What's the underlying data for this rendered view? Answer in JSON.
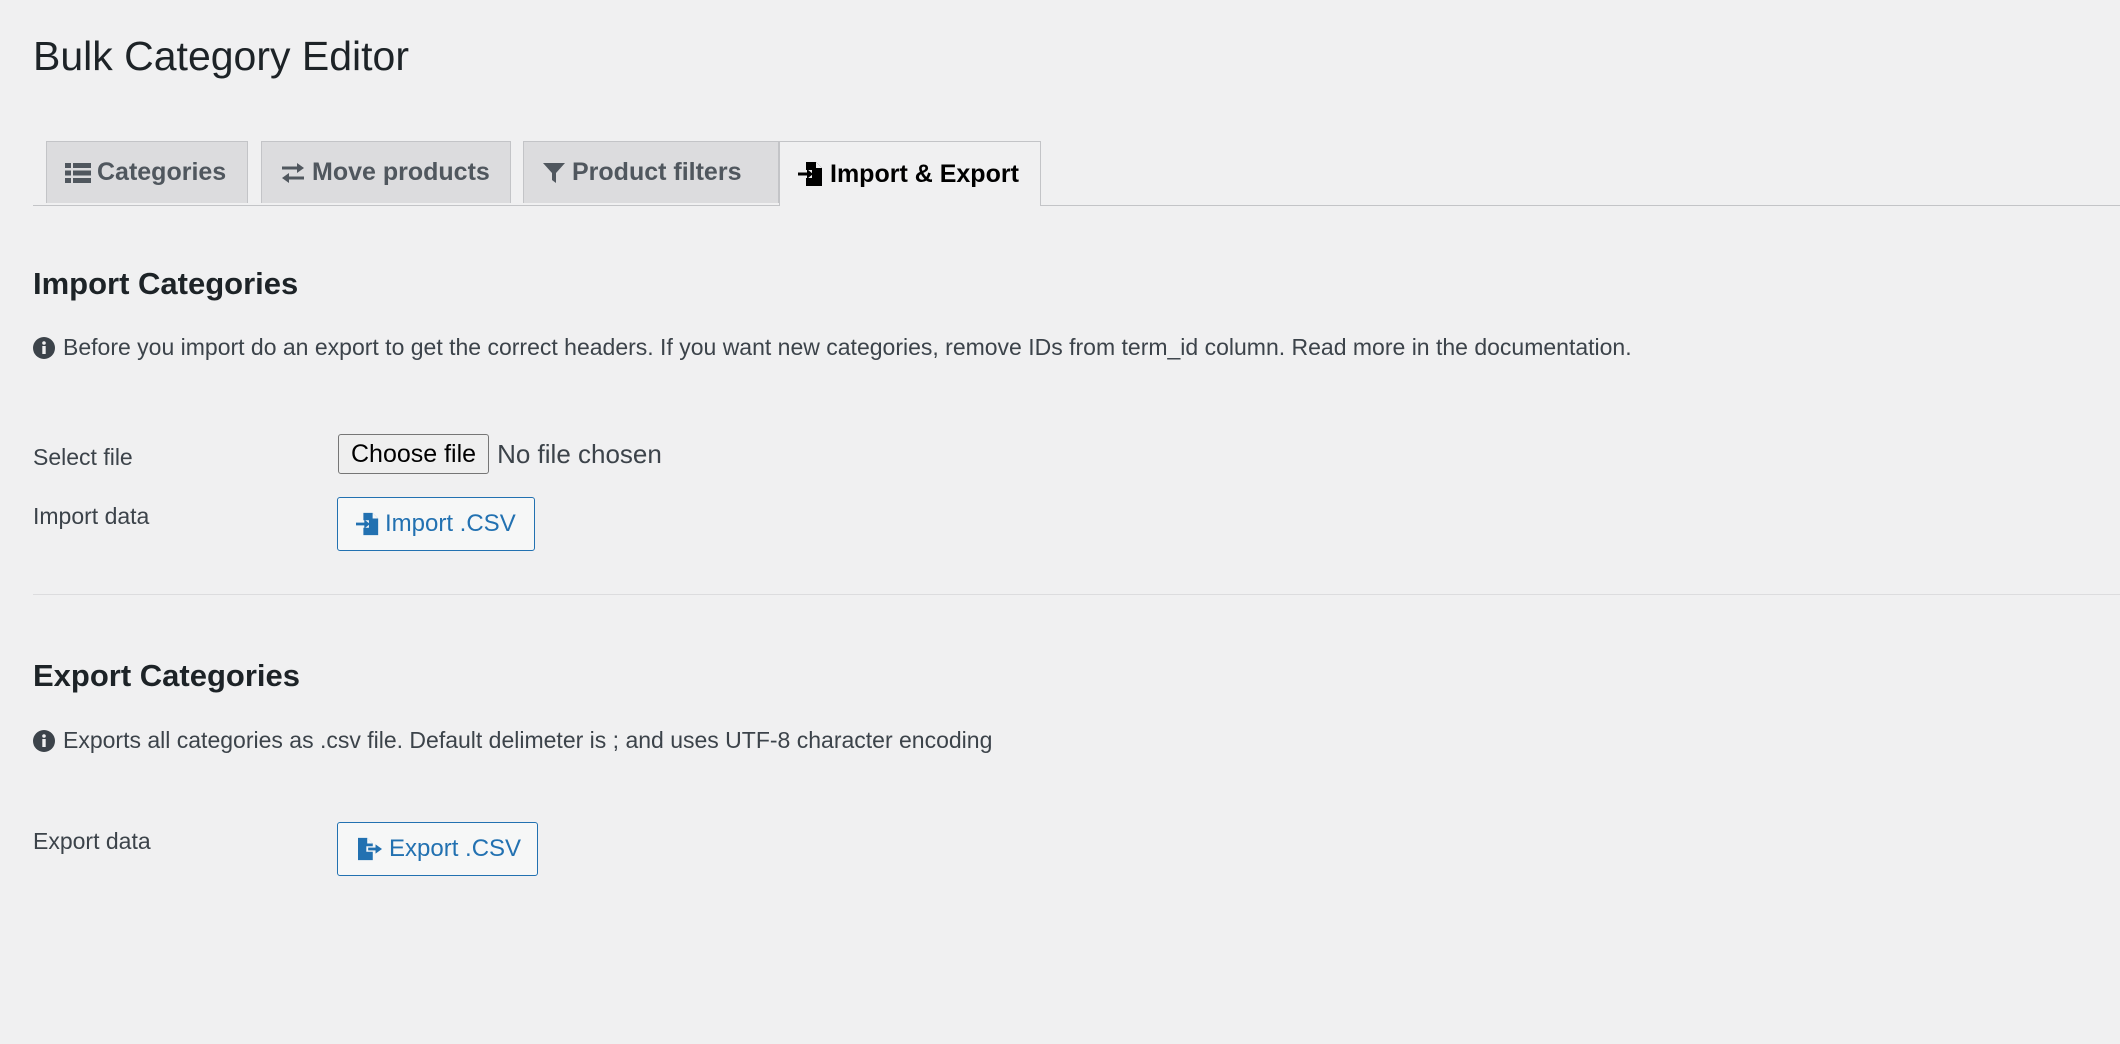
{
  "page": {
    "title": "Bulk Category Editor"
  },
  "tabs": [
    {
      "label": "Categories",
      "icon": "list-icon",
      "active": false
    },
    {
      "label": "Move products",
      "icon": "exchange-icon",
      "active": false
    },
    {
      "label": "Product filters",
      "icon": "filter-icon",
      "active": false
    },
    {
      "label": "Import & Export",
      "icon": "file-import-icon",
      "active": true
    }
  ],
  "import_section": {
    "title": "Import Categories",
    "notice": "Before you import do an export to get the correct headers. If you want new categories, remove IDs from term_id column. Read more in the documentation.",
    "select_file_label": "Select file",
    "choose_file_button": "Choose file",
    "file_status": "No file chosen",
    "import_data_label": "Import data",
    "import_button": "Import .CSV"
  },
  "export_section": {
    "title": "Export Categories",
    "notice": "Exports all categories as .csv file. Default delimeter is ; and uses UTF-8 character encoding",
    "export_data_label": "Export data",
    "export_button": "Export .CSV"
  },
  "colors": {
    "background": "#f0f0f1",
    "accent": "#2271b1",
    "text": "#3c434a",
    "heading": "#1d2327",
    "tab_inactive_bg": "#dcdcde"
  }
}
